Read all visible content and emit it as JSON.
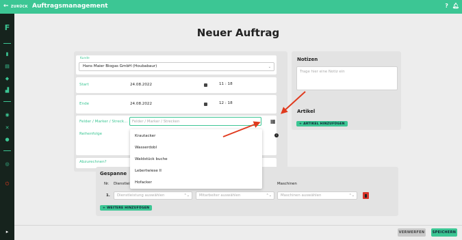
{
  "topbar": {
    "back_label": "ZURÜCK",
    "title": "Auftragsmanagement",
    "help_icon": "question-mark-icon",
    "bell_icon": "bell-icon"
  },
  "page": {
    "title": "Neuer Auftrag"
  },
  "form": {
    "kunde_label": "Kunde",
    "kunde_value": "Hans Maier Biogas GmbH (Houbabaur)",
    "start_label": "Start",
    "start_date": "24.08.2022",
    "start_time": "11 : 18",
    "ende_label": "Ende",
    "ende_date": "24.08.2022",
    "ende_time": "12 : 18",
    "felder_label": "Felder / Marker / Streck...",
    "felder_placeholder": "Felder / Marker / Strecken",
    "reihenfolge_label": "Reihenfolge",
    "abzurechnen_label": "Abzurechnen?"
  },
  "dropdown": {
    "options": [
      "Krautacker",
      "Wasserdobl",
      "Waldstück buche",
      "Lebertwiese II",
      "Hofacker"
    ]
  },
  "notizen": {
    "title": "Notizen",
    "placeholder": "Trage hier eine Notiz ein"
  },
  "artikel": {
    "title": "Artikel",
    "add_label": "ARTIKEL HINZUFÜGEN"
  },
  "gespanne": {
    "title": "Gespanne",
    "col_nr": "Nr.",
    "col_dienst": "Dienstleis",
    "col_maschinen": "Maschinen",
    "row_nr": "1.",
    "dienst_placeholder": "Dienstleistung auswählen",
    "mitarbeiter_placeholder": "Mitarbeiter auswählen",
    "maschinen_placeholder": "Maschinen auswählen",
    "add_label": "WEITERE HINZUFÜGEN"
  },
  "footer": {
    "cancel_label": "VERWERFEN",
    "save_label": "SPEICHERN"
  },
  "colors": {
    "accent": "#3cc694",
    "sidebar": "#16231d",
    "arrow": "#e03a1e",
    "delete": "#d9352b"
  }
}
